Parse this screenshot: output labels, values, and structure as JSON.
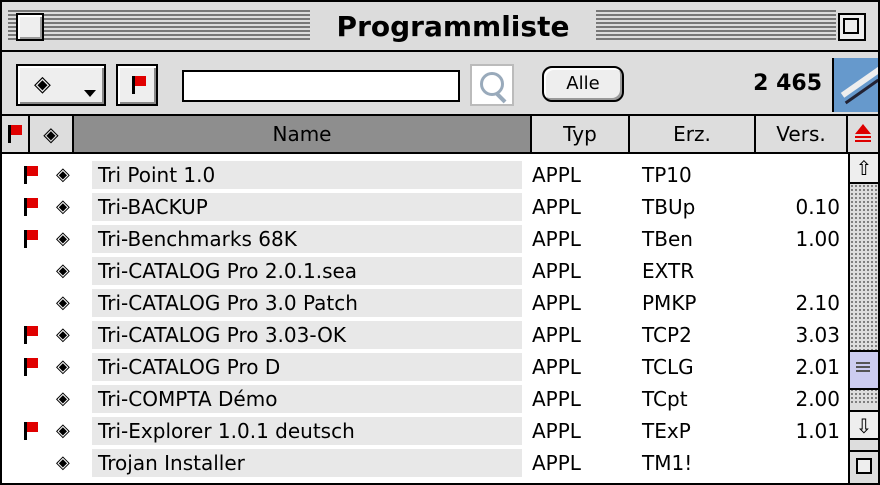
{
  "window": {
    "title": "Programmliste"
  },
  "toolbar": {
    "app_icon": "tri-app-icon",
    "search_value": "",
    "all_label": "Alle",
    "count": "2 465"
  },
  "columns": {
    "name": "Name",
    "typ": "Typ",
    "erz": "Erz.",
    "vers": "Vers."
  },
  "colors": {
    "flag": "#e00000",
    "header_selected": "#8e8e8e",
    "thumb": "#ccccf0"
  },
  "rows": [
    {
      "flag": true,
      "name": "Tri Point 1.0",
      "typ": "APPL",
      "erz": "TP10",
      "vers": ""
    },
    {
      "flag": true,
      "name": "Tri-BACKUP",
      "typ": "APPL",
      "erz": "TBUp",
      "vers": "0.10"
    },
    {
      "flag": true,
      "name": "Tri-Benchmarks 68K",
      "typ": "APPL",
      "erz": "TBen",
      "vers": "1.00"
    },
    {
      "flag": false,
      "name": "Tri-CATALOG Pro 2.0.1.sea",
      "typ": "APPL",
      "erz": "EXTR",
      "vers": ""
    },
    {
      "flag": false,
      "name": "Tri-CATALOG Pro 3.0 Patch",
      "typ": "APPL",
      "erz": "PMKP",
      "vers": "2.10"
    },
    {
      "flag": true,
      "name": "Tri-CATALOG Pro 3.03-OK",
      "typ": "APPL",
      "erz": "TCP2",
      "vers": "3.03"
    },
    {
      "flag": true,
      "name": "Tri-CATALOG Pro D",
      "typ": "APPL",
      "erz": "TCLG",
      "vers": "2.01"
    },
    {
      "flag": false,
      "name": "Tri-COMPTA Démo",
      "typ": "APPL",
      "erz": "TCpt",
      "vers": "2.00"
    },
    {
      "flag": true,
      "name": "Tri-Explorer 1.0.1 deutsch",
      "typ": "APPL",
      "erz": "TExP",
      "vers": "1.01"
    },
    {
      "flag": false,
      "name": "Trojan Installer",
      "typ": "APPL",
      "erz": "TM1!",
      "vers": ""
    }
  ]
}
